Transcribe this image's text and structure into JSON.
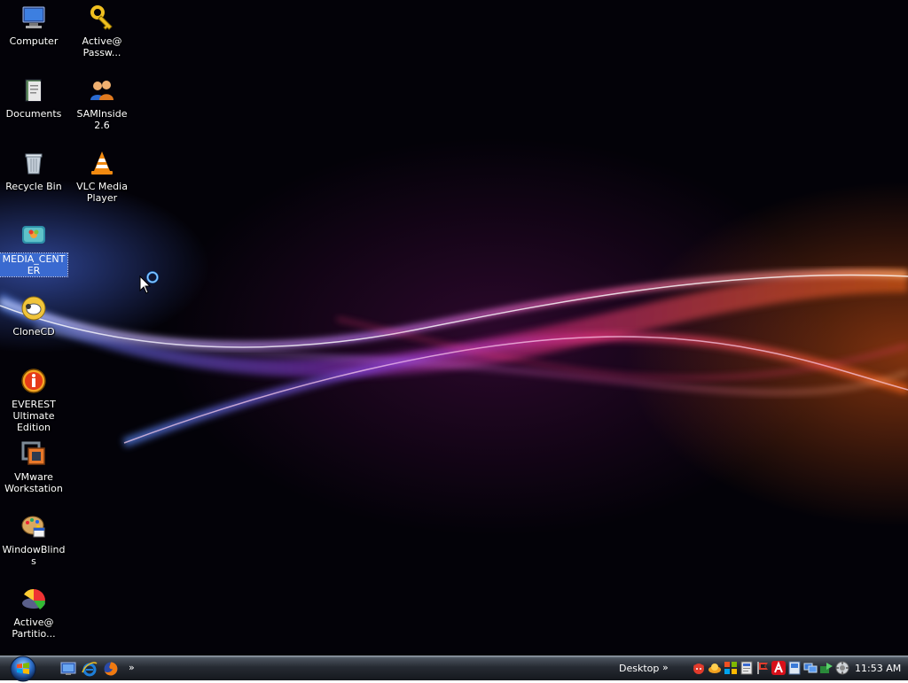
{
  "desktop": {
    "icons": [
      {
        "label": "Computer",
        "icon": "computer-icon"
      },
      {
        "label": "Active@ Passw...",
        "icon": "key-icon"
      },
      {
        "label": "Documents",
        "icon": "documents-icon"
      },
      {
        "label": "SAMInside 2.6",
        "icon": "users-icon"
      },
      {
        "label": "Recycle Bin",
        "icon": "recycle-bin-icon"
      },
      {
        "label": "VLC Media Player",
        "icon": "vlc-cone-icon"
      },
      {
        "label": "MEDIA_CENTER",
        "icon": "media-center-icon",
        "selected": true
      },
      {
        "label": "CloneCD",
        "icon": "clonecd-sheep-icon"
      },
      {
        "label": "EVEREST Ultimate Edition",
        "icon": "info-icon"
      },
      {
        "label": "VMware Workstation",
        "icon": "vmware-icon"
      },
      {
        "label": "WindowBlinds",
        "icon": "palette-icon"
      },
      {
        "label": "Active@ Partitio...",
        "icon": "partition-disk-icon"
      }
    ]
  },
  "taskbar": {
    "desktop_label": "Desktop",
    "chevron": "»",
    "clock": "11:53 AM",
    "quick_launch": [
      "show-desktop-icon",
      "internet-explorer-icon",
      "firefox-icon"
    ],
    "tray_icons": [
      "antivirus-devil-icon",
      "network-icon",
      "update-icon",
      "monitor-icon",
      "flag-icon",
      "avira-icon",
      "volume-icon",
      "display-icon",
      "sync-icon",
      "safely-remove-icon"
    ]
  },
  "colors": {
    "selection": "#3a6ad0",
    "taskbar": "#1b1f26"
  }
}
